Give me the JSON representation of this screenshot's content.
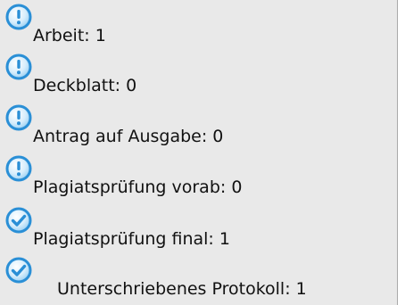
{
  "checklist": {
    "items": [
      {
        "text": "Arbeit: 1",
        "status": "info",
        "icon": "exclamation-circle-icon"
      },
      {
        "text": "Deckblatt: 0",
        "status": "info",
        "icon": "exclamation-circle-icon"
      },
      {
        "text": "Antrag auf Ausgabe: 0",
        "status": "info",
        "icon": "exclamation-circle-icon"
      },
      {
        "text": "Plagiatsprüfung vorab: 0",
        "status": "info",
        "icon": "exclamation-circle-icon"
      },
      {
        "text": "Plagiatsprüfung final: 1",
        "status": "done",
        "icon": "checkmark-circle-icon"
      },
      {
        "text": "Unterschriebenes Protokoll: 1",
        "status": "done",
        "icon": "checkmark-circle-icon"
      }
    ]
  },
  "colors": {
    "panel_background": "#e9e9e9",
    "icon_blue": "#2a8fd6",
    "icon_light": "#7ec8f2"
  }
}
